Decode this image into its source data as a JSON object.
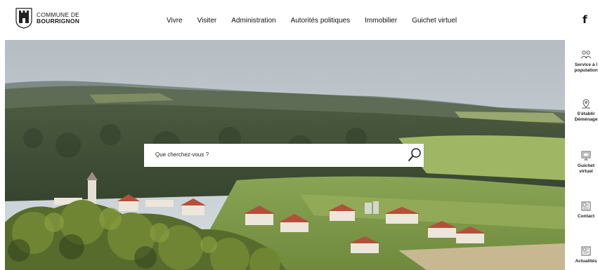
{
  "brand": {
    "line1": "COMMUNE DE",
    "line2": "BOURRIGNON"
  },
  "nav": {
    "items": [
      "Vivre",
      "Visiter",
      "Administration",
      "Autorités politiques",
      "Immobilier",
      "Guichet virtuel"
    ]
  },
  "social": {
    "facebook": "f"
  },
  "search": {
    "placeholder": "Que cherchez-vous ?"
  },
  "sidebar": {
    "items": [
      {
        "label": "Service à l\npopulation",
        "icon": "people-icon"
      },
      {
        "label": "S'établir\nDéménage",
        "icon": "location-icon"
      },
      {
        "label": "Guichet\nvirtuel",
        "icon": "computer-icon"
      },
      {
        "label": "Contact",
        "icon": "contact-card-icon"
      },
      {
        "label": "Actualités",
        "icon": "news-icon"
      }
    ]
  },
  "colors": {
    "sky": "#c8d0d6",
    "forest_dark": "#3d4a35",
    "field_green": "#7c9a4a",
    "roof_red": "#b4503a"
  }
}
